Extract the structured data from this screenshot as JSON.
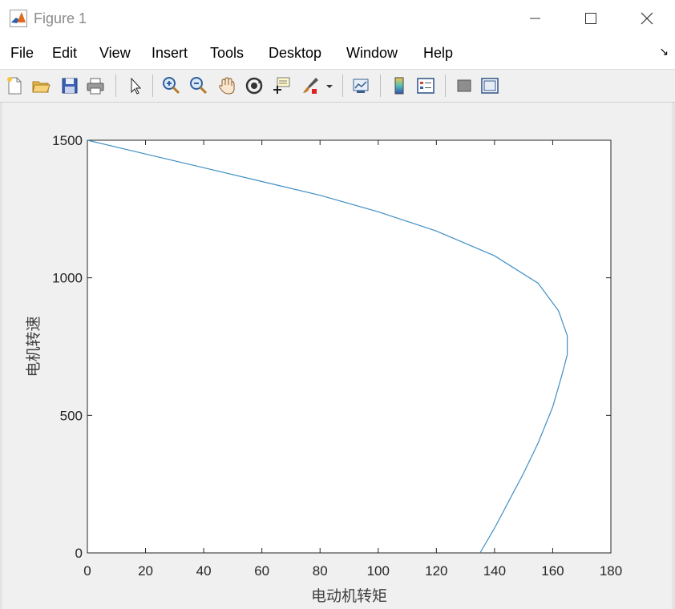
{
  "window": {
    "title": "Figure 1"
  },
  "menu": [
    "File",
    "Edit",
    "View",
    "Insert",
    "Tools",
    "Desktop",
    "Window",
    "Help"
  ],
  "toolbar": {
    "icons": [
      "new-figure-icon",
      "open-file-icon",
      "save-icon",
      "print-icon",
      "select-arrow-icon",
      "zoom-in-icon",
      "zoom-out-icon",
      "pan-hand-icon",
      "rotate-3d-icon",
      "data-cursor-icon",
      "brush-icon",
      "link-plot-icon",
      "insert-colorbar-icon",
      "insert-legend-icon",
      "hide-plot-tools-icon",
      "show-plot-tools-icon"
    ]
  },
  "colors": {
    "line": "#3f8fc4",
    "axes_bg": "#ffffff",
    "figure_bg": "#f0f0f0"
  },
  "chart_data": {
    "type": "line",
    "title": "",
    "xlabel": "电动机转矩",
    "ylabel": "电机转速",
    "xlim": [
      0,
      180
    ],
    "ylim": [
      0,
      1500
    ],
    "xticks": [
      0,
      20,
      40,
      60,
      80,
      100,
      120,
      140,
      160,
      180
    ],
    "yticks": [
      0,
      500,
      1000,
      1500
    ],
    "xtick_labels": [
      "0",
      "20",
      "40",
      "60",
      "80",
      "100",
      "120",
      "140",
      "160",
      "180"
    ],
    "ytick_labels": [
      "0",
      "500",
      "1000",
      "1500"
    ],
    "grid": false,
    "series": [
      {
        "x": [
          135,
          140,
          145,
          150,
          155,
          160,
          163,
          165,
          165,
          162,
          155,
          140,
          120,
          100,
          80,
          60,
          40,
          20,
          0
        ],
        "y": [
          0,
          90,
          190,
          290,
          400,
          530,
          640,
          720,
          790,
          880,
          980,
          1080,
          1170,
          1240,
          1300,
          1350,
          1400,
          1450,
          1500
        ]
      }
    ]
  }
}
